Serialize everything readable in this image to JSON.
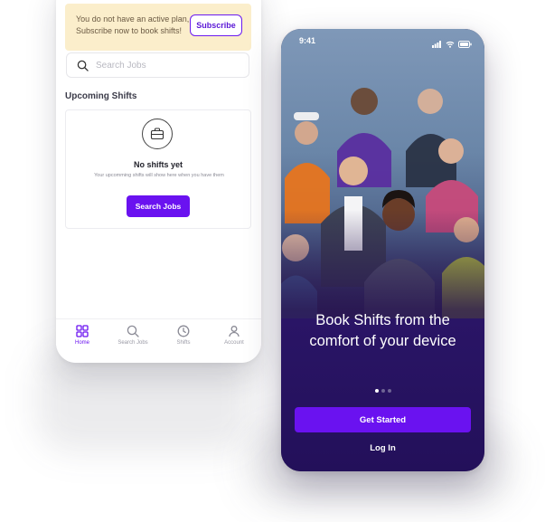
{
  "back_screen": {
    "notice": {
      "text": "You do not have an active plan, Subscribe now to book shifts!",
      "subscribe_label": "Subscribe"
    },
    "search": {
      "placeholder": "Search Jobs",
      "icon": "search-icon"
    },
    "section_title": "Upcoming Shifts",
    "empty_state": {
      "icon": "briefcase-icon",
      "title": "No shifts yet",
      "subtitle": "Your upcomming shifts will show here when you have them",
      "button_label": "Search Jobs"
    },
    "tabs": [
      {
        "label": "Home",
        "icon": "home-grid-icon",
        "active": true
      },
      {
        "label": "Search Jobs",
        "icon": "search-icon",
        "active": false
      },
      {
        "label": "Shifts",
        "icon": "clock-icon",
        "active": false
      },
      {
        "label": "Account",
        "icon": "user-icon",
        "active": false
      }
    ]
  },
  "front_screen": {
    "status_time": "9:41",
    "status_icons": [
      "signal-icon",
      "wifi-icon",
      "battery-icon"
    ],
    "headline": "Book Shifts from the comfort of your device",
    "carousel": {
      "pages": 3,
      "active": 1
    },
    "primary_button": "Get Started",
    "secondary_link": "Log In"
  },
  "colors": {
    "accent": "#6a12f0",
    "notice_bg": "#fbeecb",
    "front_bg": "#2a1566"
  }
}
